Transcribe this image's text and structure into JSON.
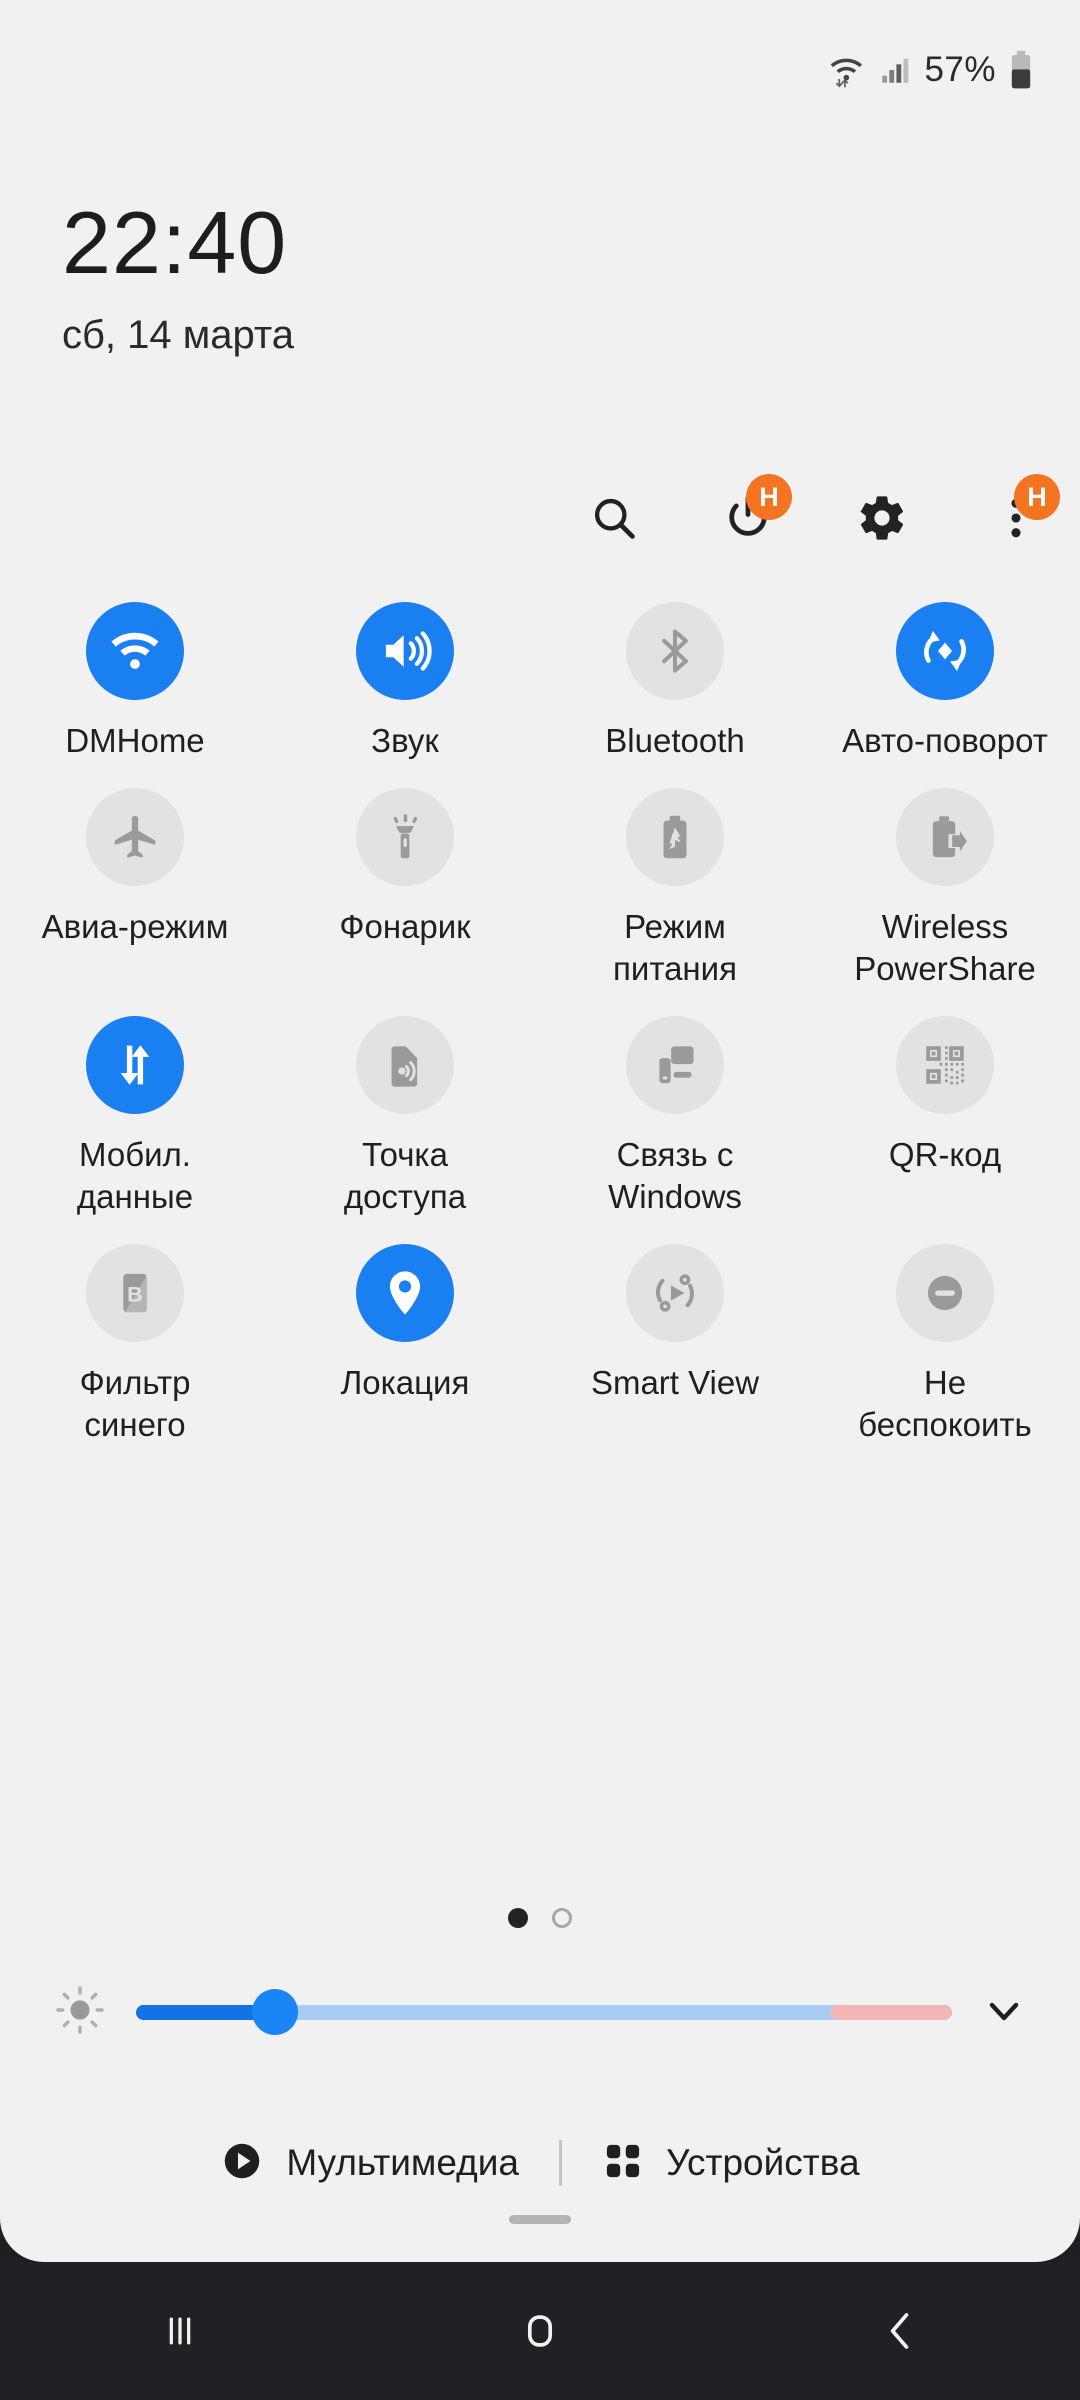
{
  "status_bar": {
    "wifi_icon": "wifi-data-icon",
    "signal_icon": "cellular-signal-icon",
    "battery_text": "57%",
    "battery_icon": "battery-icon"
  },
  "clock": {
    "time": "22:40",
    "date": "сб, 14 марта"
  },
  "header_actions": [
    {
      "name": "search-button",
      "icon": "search-icon",
      "badge": null
    },
    {
      "name": "power-button",
      "icon": "power-icon",
      "badge": "H"
    },
    {
      "name": "settings-button",
      "icon": "gear-icon",
      "badge": null
    },
    {
      "name": "more-button",
      "icon": "more-vertical-icon",
      "badge": "H"
    }
  ],
  "tiles": [
    {
      "label": "DMHome",
      "icon": "wifi-icon",
      "state": "on"
    },
    {
      "label": "Звук",
      "icon": "volume-icon",
      "state": "on"
    },
    {
      "label": "Bluetooth",
      "icon": "bluetooth-icon",
      "state": "off"
    },
    {
      "label": "Авто-поворот",
      "icon": "auto-rotate-icon",
      "state": "on"
    },
    {
      "label": "Авиа-режим",
      "icon": "airplane-icon",
      "state": "off"
    },
    {
      "label": "Фонарик",
      "icon": "flashlight-icon",
      "state": "off"
    },
    {
      "label": "Режим питания",
      "icon": "power-saving-icon",
      "state": "off"
    },
    {
      "label": "Wireless PowerShare",
      "icon": "wireless-share-icon",
      "state": "off"
    },
    {
      "label": "Мобил. данные",
      "icon": "mobile-data-icon",
      "state": "on"
    },
    {
      "label": "Точка доступа",
      "icon": "hotspot-icon",
      "state": "off"
    },
    {
      "label": "Связь с Windows",
      "icon": "link-to-windows-icon",
      "state": "off"
    },
    {
      "label": "QR-код",
      "icon": "qr-code-icon",
      "state": "off"
    },
    {
      "label": "Фильтр синего",
      "icon": "blue-light-filter-icon",
      "state": "off"
    },
    {
      "label": "Локация",
      "icon": "location-pin-icon",
      "state": "on"
    },
    {
      "label": "Smart View",
      "icon": "smart-view-icon",
      "state": "off"
    },
    {
      "label": "Не беспокоить",
      "icon": "do-not-disturb-icon",
      "state": "off"
    }
  ],
  "pager": {
    "total": 2,
    "current": 1
  },
  "brightness": {
    "icon": "brightness-icon",
    "value_percent": 17,
    "warn_start_percent": 85,
    "expand_icon": "chevron-down-icon"
  },
  "footer": {
    "media_label": "Мультимедиа",
    "media_icon": "play-circle-icon",
    "devices_label": "Устройства",
    "devices_icon": "devices-grid-icon"
  },
  "nav_bar": {
    "recents_icon": "recents-icon",
    "home_icon": "home-icon",
    "back_icon": "back-icon"
  },
  "colors": {
    "accent_on": "#1a7ff0",
    "tile_off": "#e2e2e2",
    "badge": "#f47421",
    "panel_bg": "#f1f1f1",
    "nav_bg": "#212125"
  }
}
